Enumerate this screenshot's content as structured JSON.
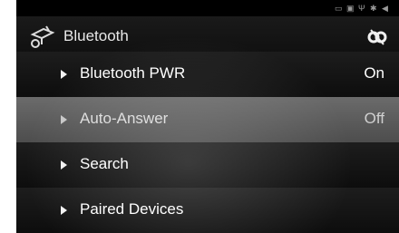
{
  "status_bar": {
    "icons": [
      "notification-icon",
      "sim-icon",
      "usb-icon",
      "bluetooth-status-icon",
      "volume-icon"
    ]
  },
  "header": {
    "title": "Bluetooth"
  },
  "menu": {
    "items": [
      {
        "label": "Bluetooth PWR",
        "value": "On"
      },
      {
        "label": "Auto-Answer",
        "value": "Off"
      },
      {
        "label": "Search",
        "value": ""
      },
      {
        "label": "Paired Devices",
        "value": ""
      }
    ]
  },
  "colors": {
    "background": "#101010",
    "selected_row": "#5f5f5f",
    "text": "#ffffff"
  }
}
